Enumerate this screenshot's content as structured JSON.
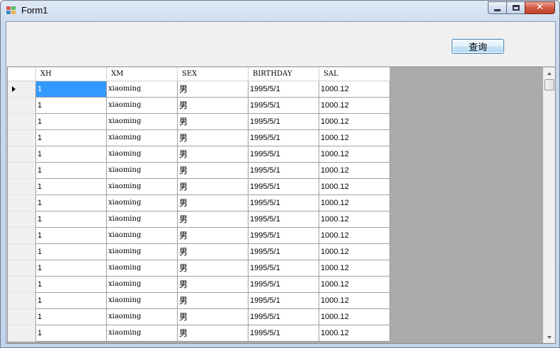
{
  "window": {
    "title": "Form1",
    "close_symbol": "✕"
  },
  "toolbar": {
    "query_label": "查询"
  },
  "grid": {
    "columns": [
      "XH",
      "XM",
      "SEX",
      "BIRTHDAY",
      "SAL"
    ],
    "rows": [
      {
        "xh": "1",
        "xm": "xiaoming",
        "sex": "男",
        "birthday": "1995/5/1",
        "sal": "1000.12"
      },
      {
        "xh": "1",
        "xm": "xiaoming",
        "sex": "男",
        "birthday": "1995/5/1",
        "sal": "1000.12"
      },
      {
        "xh": "1",
        "xm": "xiaoming",
        "sex": "男",
        "birthday": "1995/5/1",
        "sal": "1000.12"
      },
      {
        "xh": "1",
        "xm": "xiaoming",
        "sex": "男",
        "birthday": "1995/5/1",
        "sal": "1000.12"
      },
      {
        "xh": "1",
        "xm": "xiaoming",
        "sex": "男",
        "birthday": "1995/5/1",
        "sal": "1000.12"
      },
      {
        "xh": "1",
        "xm": "xiaoming",
        "sex": "男",
        "birthday": "1995/5/1",
        "sal": "1000.12"
      },
      {
        "xh": "1",
        "xm": "xiaoming",
        "sex": "男",
        "birthday": "1995/5/1",
        "sal": "1000.12"
      },
      {
        "xh": "1",
        "xm": "xiaoming",
        "sex": "男",
        "birthday": "1995/5/1",
        "sal": "1000.12"
      },
      {
        "xh": "1",
        "xm": "xiaoming",
        "sex": "男",
        "birthday": "1995/5/1",
        "sal": "1000.12"
      },
      {
        "xh": "1",
        "xm": "xiaoming",
        "sex": "男",
        "birthday": "1995/5/1",
        "sal": "1000.12"
      },
      {
        "xh": "1",
        "xm": "xiaoming",
        "sex": "男",
        "birthday": "1995/5/1",
        "sal": "1000.12"
      },
      {
        "xh": "1",
        "xm": "xiaoming",
        "sex": "男",
        "birthday": "1995/5/1",
        "sal": "1000.12"
      },
      {
        "xh": "1",
        "xm": "xiaoming",
        "sex": "男",
        "birthday": "1995/5/1",
        "sal": "1000.12"
      },
      {
        "xh": "1",
        "xm": "xiaoming",
        "sex": "男",
        "birthday": "1995/5/1",
        "sal": "1000.12"
      },
      {
        "xh": "1",
        "xm": "xiaoming",
        "sex": "男",
        "birthday": "1995/5/1",
        "sal": "1000.12"
      },
      {
        "xh": "1",
        "xm": "xiaoming",
        "sex": "男",
        "birthday": "1995/5/1",
        "sal": "1000.12"
      }
    ],
    "current_row_index": 0,
    "selection_color": "#3399ff",
    "empty_area_color": "#ababab"
  }
}
